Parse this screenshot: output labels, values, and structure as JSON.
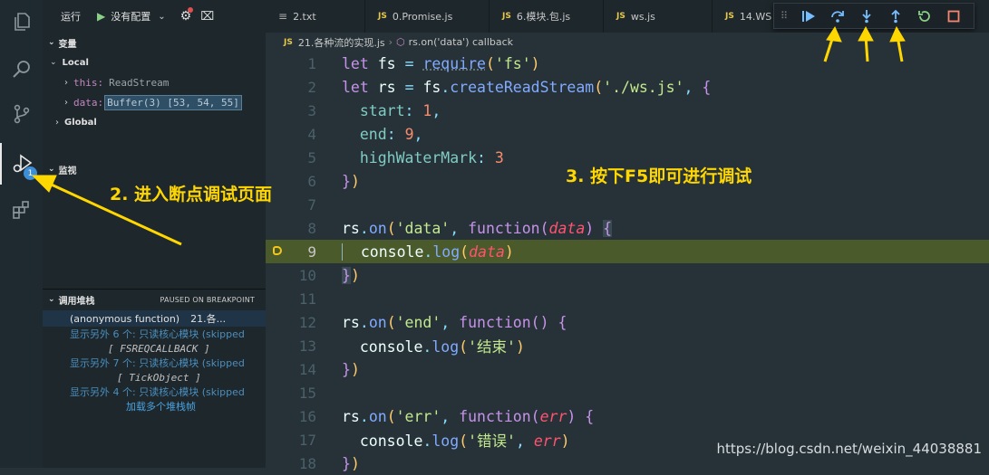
{
  "run_bar": {
    "run_label": "运行",
    "config_label": "没有配置"
  },
  "tabs": [
    {
      "label": "2.txt",
      "type": "txt"
    },
    {
      "label": "0.Promise.js",
      "type": "js"
    },
    {
      "label": "6.模块.包.js",
      "type": "js"
    },
    {
      "label": "ws.js",
      "type": "js"
    },
    {
      "label": "14.WS",
      "type": "js"
    }
  ],
  "breadcrumbs": {
    "file": "21.各种流的实现.js",
    "symbol": "rs.on('data') callback",
    "js_tag": "JS"
  },
  "activity_bar": {
    "debug_badge": "1"
  },
  "variables": {
    "title": "变量",
    "scope_local": "Local",
    "this_name": "this:",
    "this_value": "ReadStream",
    "data_name": "data:",
    "data_value": "Buffer(3) [53, 54, 55]",
    "scope_global": "Global"
  },
  "watch": {
    "title": "监视"
  },
  "call_stack": {
    "title": "调用堆栈",
    "status": "PAUSED ON BREAKPOINT",
    "frame_name": "(anonymous function)",
    "frame_file": "21.各...",
    "skipped1": "显示另外 6 个: 只读核心模块 (skipped",
    "frame2": "[ FSREQCALLBACK ]",
    "skipped2": "显示另外 7 个: 只读核心模块 (skipped",
    "frame3": "[ TickObject ]",
    "skipped3": "显示另外 4 个: 只读核心模块 (skipped",
    "load_more": "加载多个堆栈帧"
  },
  "line_numbers": [
    "1",
    "2",
    "3",
    "4",
    "5",
    "6",
    "7",
    "8",
    "9",
    "10",
    "11",
    "12",
    "13",
    "14",
    "15",
    "16",
    "17",
    "18"
  ],
  "code": {
    "l1_let": "let",
    "l1_var": "fs",
    "l1_eq": "=",
    "l1_fn": "require",
    "l1_arg": "'fs'",
    "l2_let": "let",
    "l2_var": "rs",
    "l2_eq": "=",
    "l2_obj": "fs",
    "l2_fn": "createReadStream",
    "l2_arg": "'./ws.js'",
    "l3_key": "start",
    "l3_val": "1",
    "l4_key": "end",
    "l4_val": "9",
    "l5_key": "highWaterMark",
    "l5_val": "3",
    "l8_obj": "rs",
    "l8_fn": "on",
    "l8_arg": "'data'",
    "l8_kw": "function",
    "l8_param": "data",
    "l9_obj": "console",
    "l9_fn": "log",
    "l9_param": "data",
    "l12_obj": "rs",
    "l12_fn": "on",
    "l12_arg": "'end'",
    "l12_kw": "function",
    "l13_obj": "console",
    "l13_fn": "log",
    "l13_arg": "'结束'",
    "l16_obj": "rs",
    "l16_fn": "on",
    "l16_arg": "'err'",
    "l16_kw": "function",
    "l16_param": "err",
    "l17_obj": "console",
    "l17_fn": "log",
    "l17_arg": "'错误'",
    "l17_param": "err"
  },
  "annotations": {
    "step2": "2. 进入断点调试页面",
    "step3": "3. 按下F5即可进行调试"
  },
  "watermark": "https://blog.csdn.net/weixin_44038881",
  "colors": {
    "annotation": "#ffd700",
    "highlight_line": "#4b5a2a",
    "breakpoint": "#f5c518"
  }
}
